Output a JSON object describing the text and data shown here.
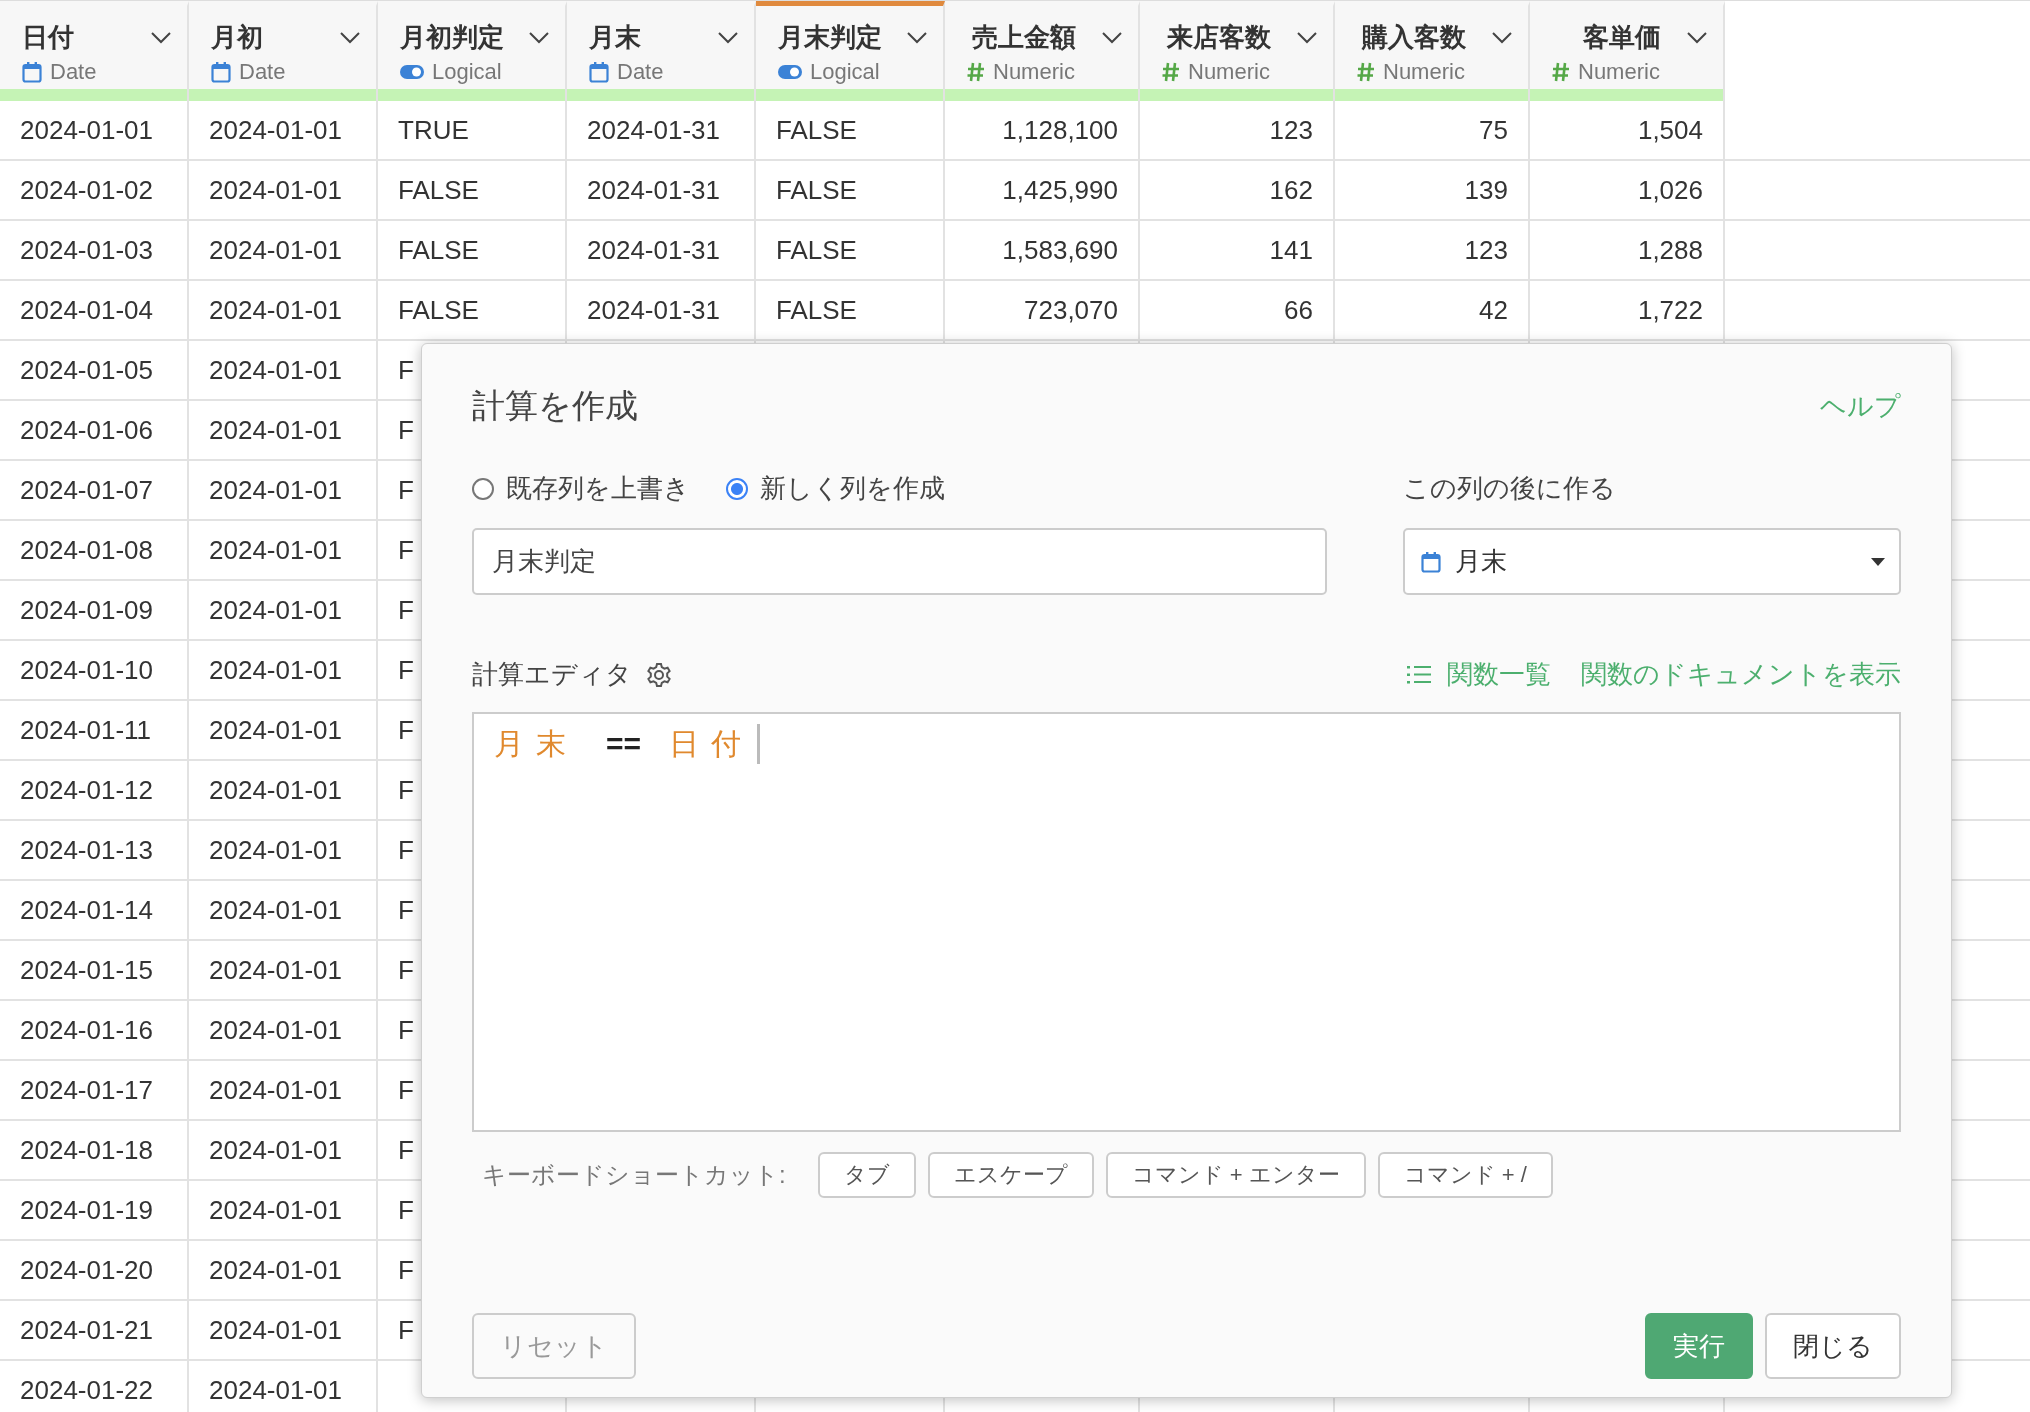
{
  "columns": [
    {
      "name": "日付",
      "kind": "date",
      "type": "Date",
      "selected": false
    },
    {
      "name": "月初",
      "kind": "date",
      "type": "Date",
      "selected": false
    },
    {
      "name": "月初判定",
      "kind": "logical",
      "type": "Logical",
      "selected": false
    },
    {
      "name": "月末",
      "kind": "date",
      "type": "Date",
      "selected": false
    },
    {
      "name": "月末判定",
      "kind": "logical",
      "type": "Logical",
      "selected": true
    },
    {
      "name": "売上金額",
      "kind": "numeric",
      "type": "Numeric",
      "selected": false
    },
    {
      "name": "来店客数",
      "kind": "numeric",
      "type": "Numeric",
      "selected": false
    },
    {
      "name": "購入客数",
      "kind": "numeric",
      "type": "Numeric",
      "selected": false
    },
    {
      "name": "客単価",
      "kind": "numeric",
      "type": "Numeric",
      "selected": false
    }
  ],
  "rows": [
    [
      "2024-01-01",
      "2024-01-01",
      "TRUE",
      "2024-01-31",
      "FALSE",
      "1,128,100",
      "123",
      "75",
      "1,504"
    ],
    [
      "2024-01-02",
      "2024-01-01",
      "FALSE",
      "2024-01-31",
      "FALSE",
      "1,425,990",
      "162",
      "139",
      "1,026"
    ],
    [
      "2024-01-03",
      "2024-01-01",
      "FALSE",
      "2024-01-31",
      "FALSE",
      "1,583,690",
      "141",
      "123",
      "1,288"
    ],
    [
      "2024-01-04",
      "2024-01-01",
      "FALSE",
      "2024-01-31",
      "FALSE",
      "723,070",
      "66",
      "42",
      "1,722"
    ],
    [
      "2024-01-05",
      "2024-01-01",
      "F"
    ],
    [
      "2024-01-06",
      "2024-01-01",
      "F"
    ],
    [
      "2024-01-07",
      "2024-01-01",
      "F"
    ],
    [
      "2024-01-08",
      "2024-01-01",
      "F"
    ],
    [
      "2024-01-09",
      "2024-01-01",
      "F"
    ],
    [
      "2024-01-10",
      "2024-01-01",
      "F"
    ],
    [
      "2024-01-11",
      "2024-01-01",
      "F"
    ],
    [
      "2024-01-12",
      "2024-01-01",
      "F"
    ],
    [
      "2024-01-13",
      "2024-01-01",
      "F"
    ],
    [
      "2024-01-14",
      "2024-01-01",
      "F"
    ],
    [
      "2024-01-15",
      "2024-01-01",
      "F"
    ],
    [
      "2024-01-16",
      "2024-01-01",
      "F"
    ],
    [
      "2024-01-17",
      "2024-01-01",
      "F"
    ],
    [
      "2024-01-18",
      "2024-01-01",
      "F"
    ],
    [
      "2024-01-19",
      "2024-01-01",
      "F"
    ],
    [
      "2024-01-20",
      "2024-01-01",
      "F"
    ],
    [
      "2024-01-21",
      "2024-01-01",
      "F"
    ],
    [
      "2024-01-22",
      "2024-01-01"
    ]
  ],
  "dialog": {
    "title": "計算を作成",
    "help": "ヘルプ",
    "modes": [
      {
        "label": "既存列を上書き",
        "selected": false
      },
      {
        "label": "新しく列を作成",
        "selected": true
      }
    ],
    "after_label": "この列の後に作る",
    "name_input": {
      "value": "月末判定"
    },
    "after_column": {
      "value": "月末",
      "kind": "date"
    },
    "editor_label": "計算エディタ",
    "function_list": "関数一覧",
    "docs_link": "関数のドキュメントを表示",
    "formula": [
      {
        "text": "月末",
        "kind": "column"
      },
      {
        "text": "==",
        "kind": "operator"
      },
      {
        "text": "日付",
        "kind": "column"
      }
    ],
    "shortcuts_label": "キーボードショートカット:",
    "shortcuts": [
      "タブ",
      "エスケープ",
      "コマンド + エンター",
      "コマンド + /"
    ],
    "reset": {
      "label": "リセット",
      "disabled": true
    },
    "run": "実行",
    "close": "閉じる"
  }
}
